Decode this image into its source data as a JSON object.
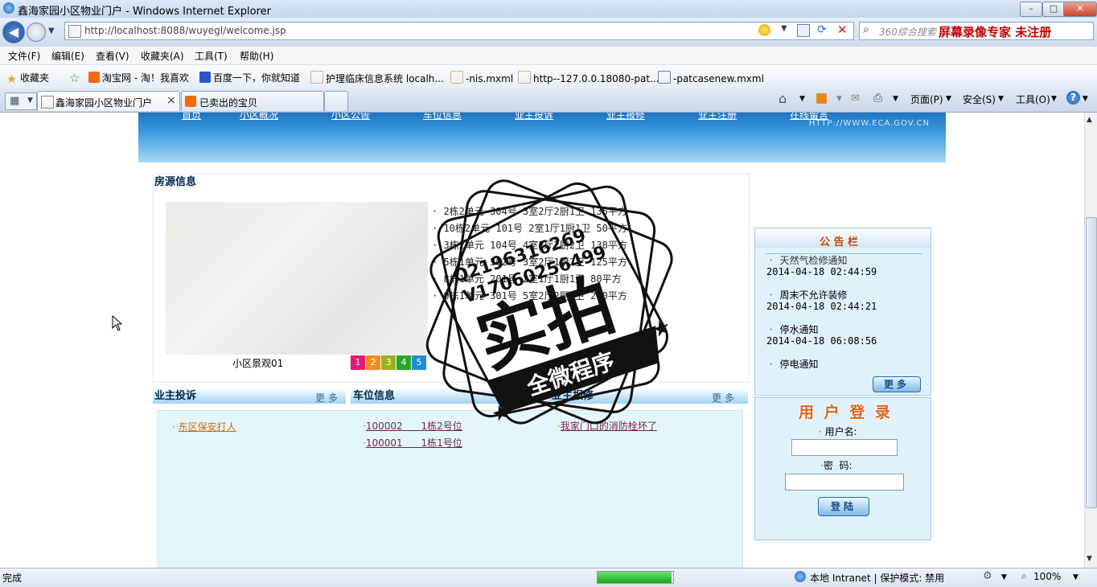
{
  "window": {
    "title": "鑫海家园小区物业门户 - Windows Internet Explorer",
    "controls": [
      "–",
      "□",
      "✕"
    ]
  },
  "address": {
    "url": "http://localhost:8088/wuyegl/welcome.jsp",
    "search_placeholder": "360综合搜索",
    "promo": "屏幕录像专家  未注册"
  },
  "menu": [
    "文件(F)",
    "编辑(E)",
    "查看(V)",
    "收藏夹(A)",
    "工具(T)",
    "帮助(H)"
  ],
  "favorites": {
    "label": "收藏夹",
    "items": [
      "淘宝网 - 淘！我喜欢",
      "百度一下，你就知道",
      "护理临床信息系统 localh...",
      "-nis.mxml",
      "http--127.0.0.18080-pat...",
      "-patcasenew.mxml"
    ]
  },
  "tabs": [
    {
      "label": "鑫海家园小区物业门户"
    },
    {
      "label": "已卖出的宝贝"
    }
  ],
  "tab_close": "×",
  "commands": [
    "页面(P)",
    "安全(S)",
    "工具(O)"
  ],
  "banner": {
    "nav": [
      "首页",
      "小区概况",
      "小区公告",
      "车位信息",
      "业主投诉",
      "业主报修",
      "业主注册",
      "在线留言"
    ],
    "url_text": "HTTP://WWW.ECA.GOV.CN"
  },
  "houses": {
    "title": "房源信息",
    "photo_caption": "小区景观01",
    "pager": [
      "1",
      "2",
      "3",
      "4",
      "5"
    ],
    "pager_colors": [
      "#e0197b",
      "#f08c1a",
      "#96b51d",
      "#2aa52a",
      "#1d8ed8"
    ],
    "items": [
      "2栋2单元 304号 3室2厅2厨1卫 135平方",
      "10栋2单元 101号 2室1厅1厨1卫 50平方",
      "3栋2单元 104号 4室2厅2厨2卫 138平方",
      "5栋1单元 502号 3室2厅1厨2卫 125平方",
      "8栋1单元 201号 2室1厅1厨1卫 80平方",
      "9栋1单元 301号 5室2厅2厨2卫 200平方"
    ]
  },
  "complaints": {
    "title": "业主投诉",
    "more": "更多",
    "items": [
      "东区保安打人"
    ]
  },
  "parking": {
    "title": "车位信息",
    "items": [
      {
        "no": "100002",
        "loc": "1栋2号位"
      },
      {
        "no": "100001",
        "loc": "1栋1号位"
      }
    ]
  },
  "repairs": {
    "title": "业主报修",
    "more": "更多",
    "items": [
      "我家门口的消防栓坏了"
    ]
  },
  "notices": {
    "title": "公 告 栏",
    "items": [
      {
        "title": "天然气检修通知",
        "time": "2014-04-18 02:44:59"
      },
      {
        "title": "周末不允许装修",
        "time": "2014-04-18 02:44:21"
      },
      {
        "title": "停水通知",
        "time": "2014-04-18 06:08:56"
      },
      {
        "title": "停电通知",
        "time": ""
      }
    ],
    "more": "更多"
  },
  "login": {
    "title": "用 户 登 录",
    "username_label": "用户名:",
    "password_label": "密  码:",
    "submit": "登陆",
    "username_value": "",
    "password_value": ""
  },
  "status": {
    "text": "完成",
    "zone": "本地 Intranet | 保护模式: 禁用",
    "zoom": "100%",
    "progress": 1.0
  },
  "watermark": {
    "qq": "Q2196316269",
    "v": "V17060256499",
    "big": "实拍",
    "ribbon": "全微程序"
  }
}
